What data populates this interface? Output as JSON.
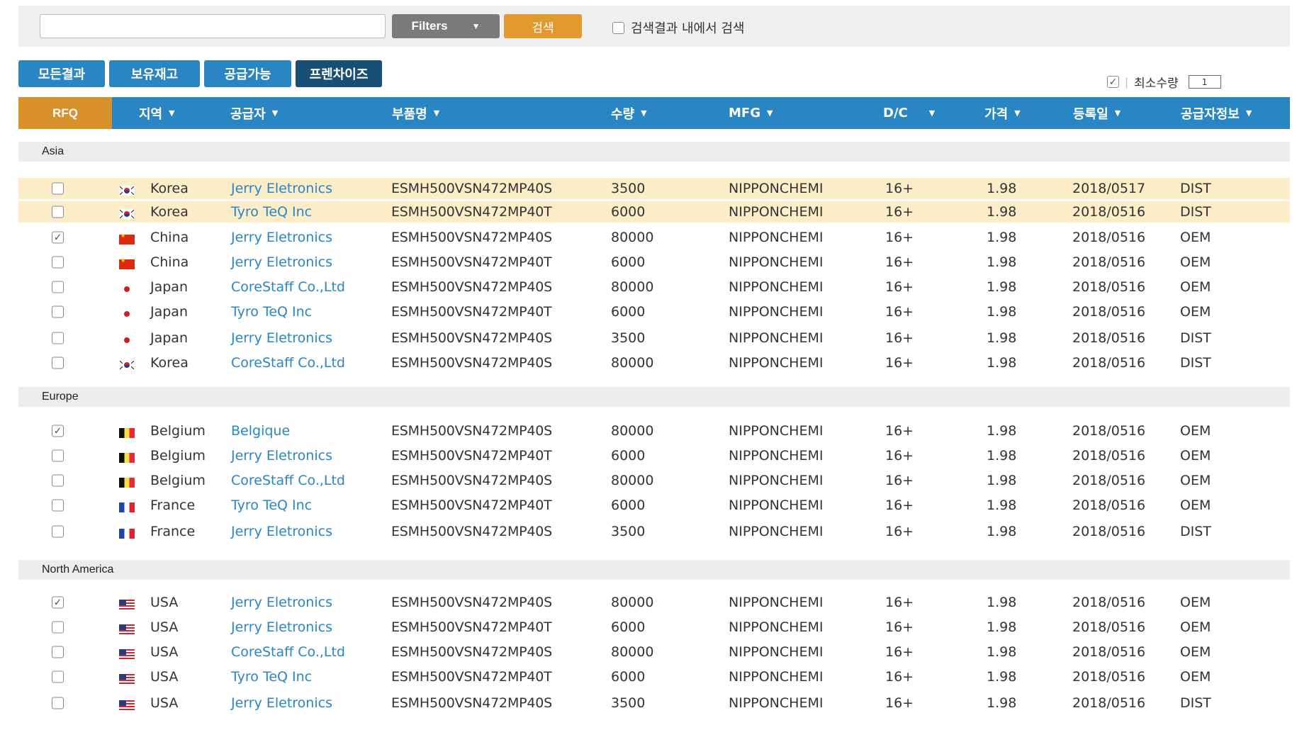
{
  "search": {
    "placeholder": "",
    "filters_label": "Filters",
    "search_label": "검색",
    "within_label": "검색결과 내에서 검색",
    "within_checked": false
  },
  "tabs": [
    {
      "label": "모든결과",
      "active": false
    },
    {
      "label": "보유재고",
      "active": false
    },
    {
      "label": "공급가능",
      "active": false
    },
    {
      "label": "프렌차이즈",
      "active": true
    }
  ],
  "min_qty": {
    "label": "최소수량",
    "checked": true,
    "value": "1"
  },
  "columns": {
    "rfq": "RFQ",
    "region": "지역",
    "supplier": "공급자",
    "part": "부품명",
    "qty": "수량",
    "mfg": "MFG",
    "dc": "D/C",
    "price": "가격",
    "date": "등록일",
    "info": "공급자정보"
  },
  "groups": [
    {
      "name": "Asia",
      "rows": [
        {
          "checked": false,
          "highlight": true,
          "flag": "korea-flag-icon",
          "country": "Korea",
          "supplier": "Jerry Eletronics",
          "part": "ESMH500VSN472MP40S",
          "qty": "3500",
          "mfg": "NIPPONCHEMI",
          "dc": "16+",
          "price": "1.98",
          "date": "2018/0517",
          "info": "DIST"
        },
        {
          "checked": false,
          "highlight": true,
          "flag": "korea-flag-icon",
          "country": "Korea",
          "supplier": "Tyro TeQ Inc",
          "part": "ESMH500VSN472MP40T",
          "qty": "6000",
          "mfg": "NIPPONCHEMI",
          "dc": "16+",
          "price": "1.98",
          "date": "2018/0516",
          "info": "DIST"
        },
        {
          "checked": true,
          "highlight": false,
          "flag": "china-flag-icon",
          "country": "China",
          "supplier": "Jerry Eletronics",
          "part": "ESMH500VSN472MP40S",
          "qty": "80000",
          "mfg": "NIPPONCHEMI",
          "dc": "16+",
          "price": "1.98",
          "date": "2018/0516",
          "info": "OEM"
        },
        {
          "checked": false,
          "highlight": false,
          "flag": "china-flag-icon",
          "country": "China",
          "supplier": "Jerry Eletronics",
          "part": "ESMH500VSN472MP40T",
          "qty": "6000",
          "mfg": "NIPPONCHEMI",
          "dc": "16+",
          "price": "1.98",
          "date": "2018/0516",
          "info": "OEM"
        },
        {
          "checked": false,
          "highlight": false,
          "flag": "japan-flag-icon",
          "country": "Japan",
          "supplier": "CoreStaff Co.,Ltd",
          "part": "ESMH500VSN472MP40S",
          "qty": "80000",
          "mfg": "NIPPONCHEMI",
          "dc": "16+",
          "price": "1.98",
          "date": "2018/0516",
          "info": "OEM"
        },
        {
          "checked": false,
          "highlight": false,
          "flag": "japan-flag-icon",
          "country": "Japan",
          "supplier": "Tyro TeQ Inc",
          "part": "ESMH500VSN472MP40T",
          "qty": "6000",
          "mfg": "NIPPONCHEMI",
          "dc": "16+",
          "price": "1.98",
          "date": "2018/0516",
          "info": "OEM"
        },
        {
          "checked": false,
          "highlight": false,
          "flag": "japan-flag-icon",
          "country": "Japan",
          "supplier": "Jerry Eletronics",
          "part": "ESMH500VSN472MP40S",
          "qty": "3500",
          "mfg": "NIPPONCHEMI",
          "dc": "16+",
          "price": "1.98",
          "date": "2018/0516",
          "info": "DIST"
        },
        {
          "checked": false,
          "highlight": false,
          "flag": "korea-flag-icon",
          "country": "Korea",
          "supplier": "CoreStaff Co.,Ltd",
          "part": "ESMH500VSN472MP40S",
          "qty": "80000",
          "mfg": "NIPPONCHEMI",
          "dc": "16+",
          "price": "1.98",
          "date": "2018/0516",
          "info": "DIST"
        }
      ]
    },
    {
      "name": "Europe",
      "rows": [
        {
          "checked": true,
          "highlight": false,
          "flag": "belgium-flag-icon",
          "country": "Belgium",
          "supplier": "Belgique",
          "part": "ESMH500VSN472MP40S",
          "qty": "80000",
          "mfg": "NIPPONCHEMI",
          "dc": "16+",
          "price": "1.98",
          "date": "2018/0516",
          "info": "OEM"
        },
        {
          "checked": false,
          "highlight": false,
          "flag": "belgium-flag-icon",
          "country": "Belgium",
          "supplier": "Jerry Eletronics",
          "part": "ESMH500VSN472MP40T",
          "qty": "6000",
          "mfg": "NIPPONCHEMI",
          "dc": "16+",
          "price": "1.98",
          "date": "2018/0516",
          "info": "OEM"
        },
        {
          "checked": false,
          "highlight": false,
          "flag": "belgium-flag-icon",
          "country": "Belgium",
          "supplier": "CoreStaff Co.,Ltd",
          "part": "ESMH500VSN472MP40S",
          "qty": "80000",
          "mfg": "NIPPONCHEMI",
          "dc": "16+",
          "price": "1.98",
          "date": "2018/0516",
          "info": "OEM"
        },
        {
          "checked": false,
          "highlight": false,
          "flag": "france-flag-icon",
          "country": "France",
          "supplier": "Tyro TeQ Inc",
          "part": "ESMH500VSN472MP40T",
          "qty": "6000",
          "mfg": "NIPPONCHEMI",
          "dc": "16+",
          "price": "1.98",
          "date": "2018/0516",
          "info": "OEM"
        },
        {
          "checked": false,
          "highlight": false,
          "flag": "france-flag-icon",
          "country": "France",
          "supplier": "Jerry Eletronics",
          "part": "ESMH500VSN472MP40S",
          "qty": "3500",
          "mfg": "NIPPONCHEMI",
          "dc": "16+",
          "price": "1.98",
          "date": "2018/0516",
          "info": "DIST"
        }
      ]
    },
    {
      "name": "North America",
      "rows": [
        {
          "checked": true,
          "highlight": false,
          "flag": "usa-flag-icon",
          "country": "USA",
          "supplier": "Jerry Eletronics",
          "part": "ESMH500VSN472MP40S",
          "qty": "80000",
          "mfg": "NIPPONCHEMI",
          "dc": "16+",
          "price": "1.98",
          "date": "2018/0516",
          "info": "OEM"
        },
        {
          "checked": false,
          "highlight": false,
          "flag": "usa-flag-icon",
          "country": "USA",
          "supplier": "Jerry Eletronics",
          "part": "ESMH500VSN472MP40T",
          "qty": "6000",
          "mfg": "NIPPONCHEMI",
          "dc": "16+",
          "price": "1.98",
          "date": "2018/0516",
          "info": "OEM"
        },
        {
          "checked": false,
          "highlight": false,
          "flag": "usa-flag-icon",
          "country": "USA",
          "supplier": "CoreStaff Co.,Ltd",
          "part": "ESMH500VSN472MP40S",
          "qty": "80000",
          "mfg": "NIPPONCHEMI",
          "dc": "16+",
          "price": "1.98",
          "date": "2018/0516",
          "info": "OEM"
        },
        {
          "checked": false,
          "highlight": false,
          "flag": "usa-flag-icon",
          "country": "USA",
          "supplier": "Tyro TeQ Inc",
          "part": "ESMH500VSN472MP40T",
          "qty": "6000",
          "mfg": "NIPPONCHEMI",
          "dc": "16+",
          "price": "1.98",
          "date": "2018/0516",
          "info": "OEM"
        },
        {
          "checked": false,
          "highlight": false,
          "flag": "usa-flag-icon",
          "country": "USA",
          "supplier": "Jerry Eletronics",
          "part": "ESMH500VSN472MP40S",
          "qty": "3500",
          "mfg": "NIPPONCHEMI",
          "dc": "16+",
          "price": "1.98",
          "date": "2018/0516",
          "info": "DIST"
        }
      ]
    }
  ]
}
